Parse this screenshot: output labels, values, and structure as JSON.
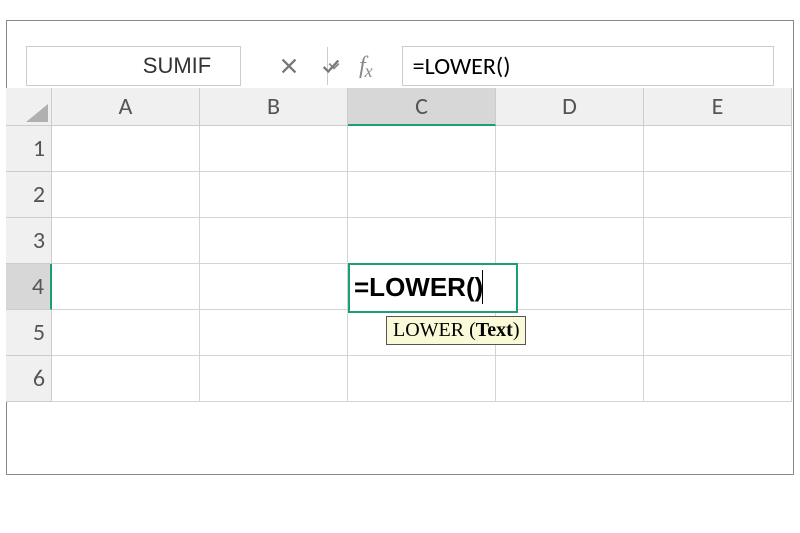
{
  "name_box": {
    "value": "SUMIF"
  },
  "formula_input": {
    "value": "=LOWER()"
  },
  "columns": [
    "A",
    "B",
    "C",
    "D",
    "E"
  ],
  "rows": [
    "1",
    "2",
    "3",
    "4",
    "5",
    "6"
  ],
  "active_column_index": 2,
  "active_row_index": 3,
  "active_cell": {
    "edit_text": "=LOWER()"
  },
  "tooltip": {
    "fn_label": "LOWER (",
    "arg_label": "Text",
    "close": ")"
  }
}
